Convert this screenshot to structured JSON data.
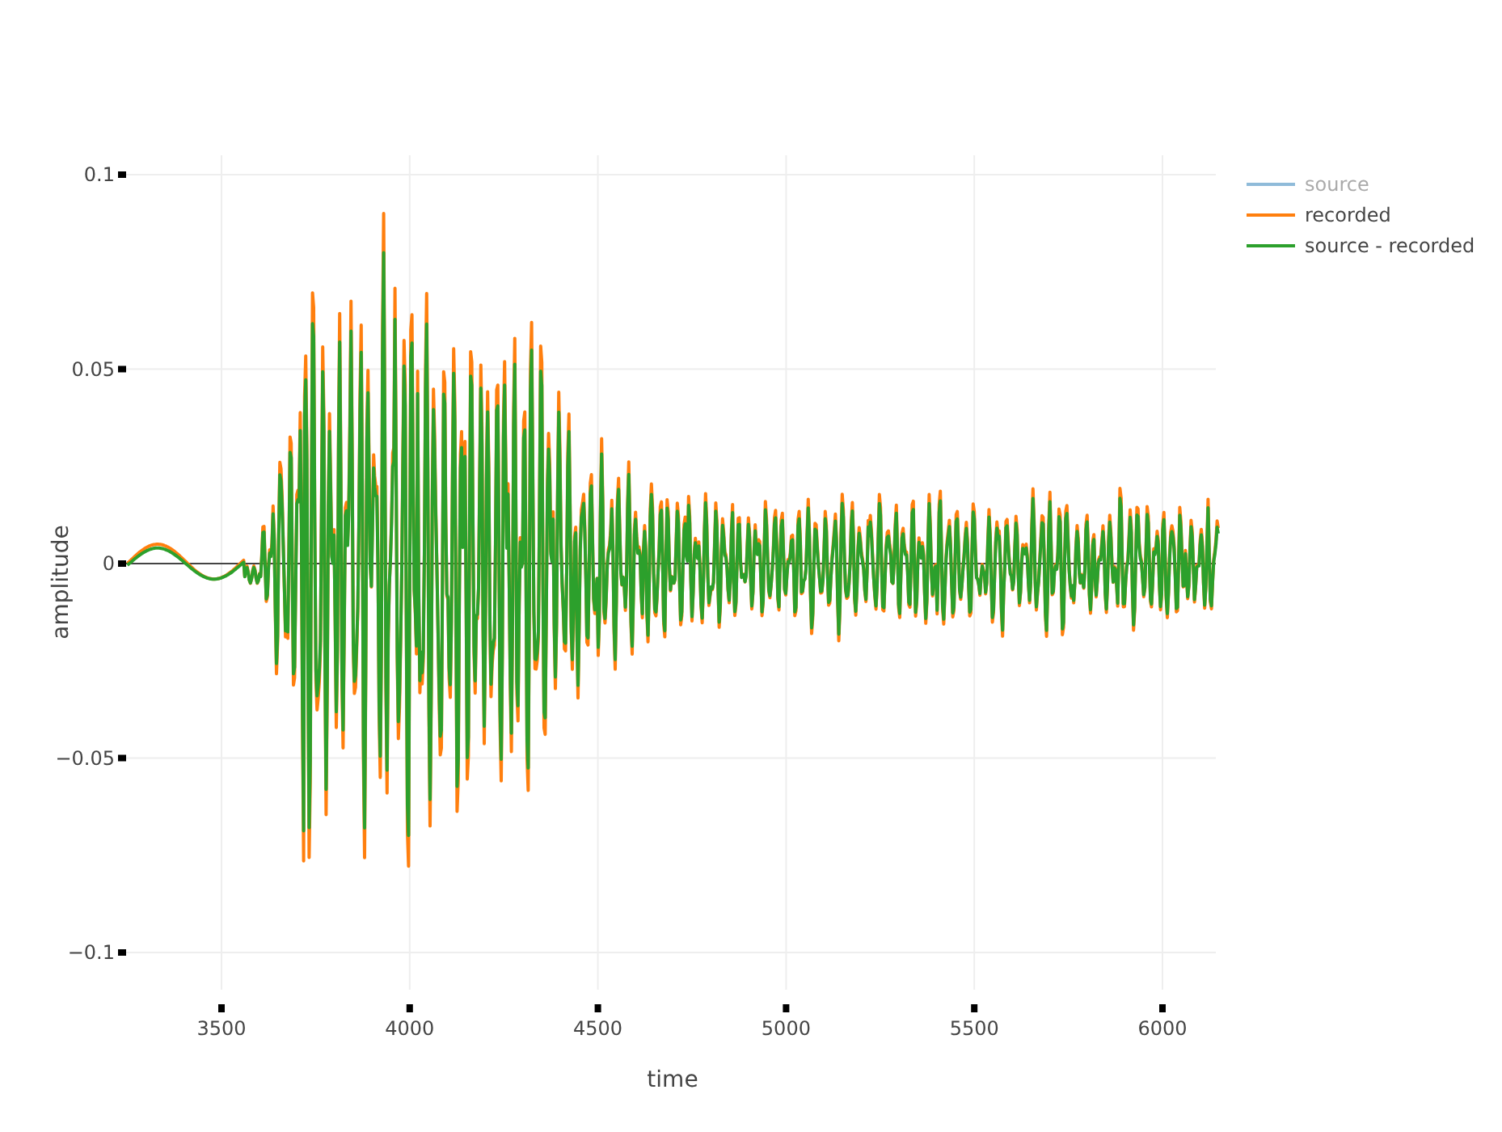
{
  "chart": {
    "ylabel": "amplitude",
    "xlabel": "time",
    "yticks": [
      "0.1",
      "0.05",
      "0",
      "−0.05",
      "−0.1"
    ],
    "xticks": [
      "3500",
      "4000",
      "4500",
      "5000",
      "5500",
      "6000"
    ],
    "legend": [
      {
        "label": "source",
        "color": "#8fbbd9",
        "visible": false
      },
      {
        "label": "recorded",
        "color": "#ff7f0e",
        "visible": true
      },
      {
        "label": "source - recorded",
        "color": "#2ca02c",
        "visible": true
      }
    ]
  }
}
